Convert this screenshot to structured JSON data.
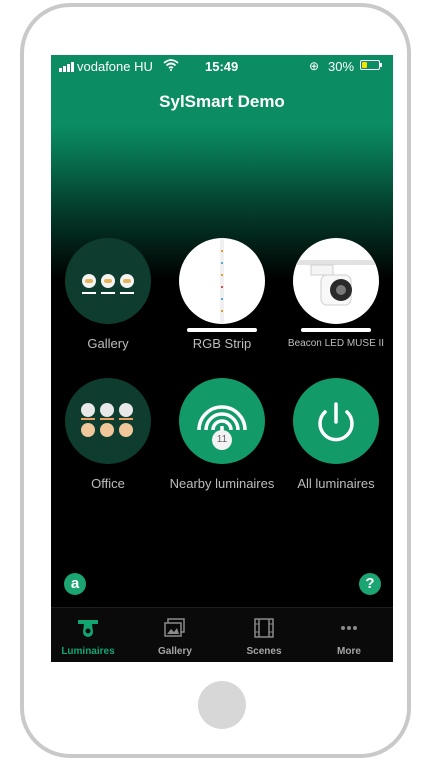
{
  "status_bar": {
    "carrier": "vodafone HU",
    "time": "15:49",
    "battery": "30%",
    "battery_level": 0.3,
    "icons": [
      "signal-icon",
      "wifi-icon",
      "rotation-lock-icon",
      "battery-icon"
    ]
  },
  "nav": {
    "title": "SylSmart Demo"
  },
  "tiles": [
    {
      "label": "Gallery",
      "icon": "lamp-group-icon"
    },
    {
      "label": "RGB Strip",
      "icon": "led-strip-image"
    },
    {
      "label": "Beacon LED MUSE II",
      "icon": "spotlight-image"
    },
    {
      "label": "Office",
      "icon": "lamp-grid-icon"
    },
    {
      "label": "Nearby luminaires",
      "icon": "broadcast-icon",
      "badge": "11"
    },
    {
      "label": "All luminaires",
      "icon": "power-icon"
    }
  ],
  "footer": {
    "left_icon": "a",
    "right_icon": "?"
  },
  "tab_bar": {
    "tabs": [
      {
        "label": "Luminaires",
        "icon": "luminaire-icon",
        "active": true
      },
      {
        "label": "Gallery",
        "icon": "gallery-icon",
        "active": false
      },
      {
        "label": "Scenes",
        "icon": "film-icon",
        "active": false
      },
      {
        "label": "More",
        "icon": "more-icon",
        "active": false
      }
    ]
  },
  "colors": {
    "accent": "#129a69",
    "active_tab": "#12a572",
    "battery": "#f2e400"
  }
}
